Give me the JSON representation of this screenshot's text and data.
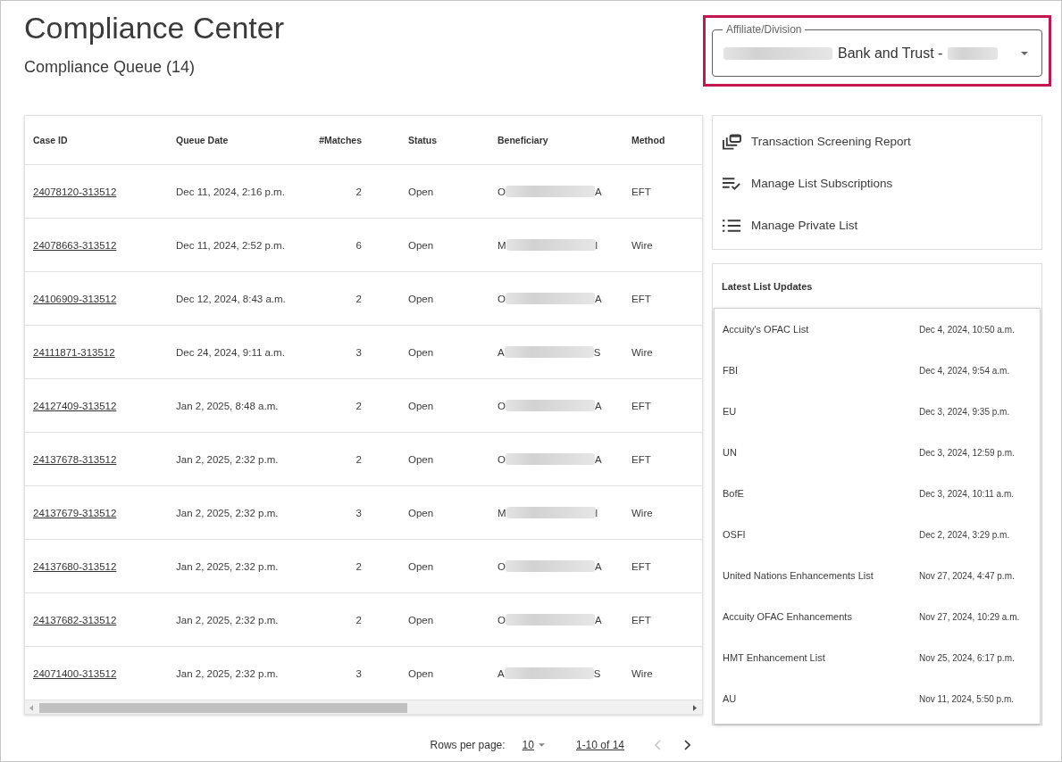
{
  "header": {
    "title": "Compliance Center",
    "subtitle": "Compliance Queue (14)"
  },
  "affiliate_field": {
    "label": "Affiliate/Division",
    "value": "Bank and Trust -",
    "highlighted": true
  },
  "table": {
    "columns": [
      "Case ID",
      "Queue Date",
      "#Matches",
      "Status",
      "Beneficiary",
      "Method"
    ],
    "rows": [
      {
        "case_id": "24078120-313512",
        "queue_date": "Dec 11, 2024, 2:16 p.m.",
        "matches": "2",
        "status": "Open",
        "beneficiary": {
          "first": "O",
          "last": "A"
        },
        "method": "EFT"
      },
      {
        "case_id": "24078663-313512",
        "queue_date": "Dec 11, 2024, 2:52 p.m.",
        "matches": "6",
        "status": "Open",
        "beneficiary": {
          "first": "M",
          "last": "l"
        },
        "method": "Wire"
      },
      {
        "case_id": "24106909-313512",
        "queue_date": "Dec 12, 2024, 8:43 a.m.",
        "matches": "2",
        "status": "Open",
        "beneficiary": {
          "first": "O",
          "last": "A"
        },
        "method": "EFT"
      },
      {
        "case_id": "24111871-313512",
        "queue_date": "Dec 24, 2024, 9:11 a.m.",
        "matches": "3",
        "status": "Open",
        "beneficiary": {
          "first": "A",
          "last": "S"
        },
        "method": "Wire"
      },
      {
        "case_id": "24127409-313512",
        "queue_date": "Jan 2, 2025, 8:48 a.m.",
        "matches": "2",
        "status": "Open",
        "beneficiary": {
          "first": "O",
          "last": "A"
        },
        "method": "EFT"
      },
      {
        "case_id": "24137678-313512",
        "queue_date": "Jan 2, 2025, 2:32 p.m.",
        "matches": "2",
        "status": "Open",
        "beneficiary": {
          "first": "O",
          "last": "A"
        },
        "method": "EFT"
      },
      {
        "case_id": "24137679-313512",
        "queue_date": "Jan 2, 2025, 2:32 p.m.",
        "matches": "3",
        "status": "Open",
        "beneficiary": {
          "first": "M",
          "last": "l"
        },
        "method": "Wire"
      },
      {
        "case_id": "24137680-313512",
        "queue_date": "Jan 2, 2025, 2:32 p.m.",
        "matches": "2",
        "status": "Open",
        "beneficiary": {
          "first": "O",
          "last": "A"
        },
        "method": "EFT"
      },
      {
        "case_id": "24137682-313512",
        "queue_date": "Jan 2, 2025, 2:32 p.m.",
        "matches": "2",
        "status": "Open",
        "beneficiary": {
          "first": "O",
          "last": "A"
        },
        "method": "EFT"
      },
      {
        "case_id": "24071400-313512",
        "queue_date": "Jan 2, 2025, 2:32 p.m.",
        "matches": "3",
        "status": "Open",
        "beneficiary": {
          "first": "A",
          "last": "S"
        },
        "method": "Wire"
      }
    ]
  },
  "pagination": {
    "rows_per_page_label": "Rows per page:",
    "rows_per_page": "10",
    "range": "1-10 of 14",
    "prev_disabled": true,
    "next_disabled": false
  },
  "actions": [
    {
      "label": "Transaction Screening Report"
    },
    {
      "label": "Manage List Subscriptions"
    },
    {
      "label": "Manage Private List"
    }
  ],
  "latest_updates": {
    "title": "Latest List Updates",
    "items": [
      {
        "name": "Accuity's OFAC List",
        "date": "Dec 4, 2024, 10:50 a.m."
      },
      {
        "name": "FBI",
        "date": "Dec 4, 2024, 9:54 a.m."
      },
      {
        "name": "EU",
        "date": "Dec 3, 2024, 9:35 p.m."
      },
      {
        "name": "UN",
        "date": "Dec 3, 2024, 12:59 p.m."
      },
      {
        "name": "BofE",
        "date": "Dec 3, 2024, 10:11 a.m."
      },
      {
        "name": "OSFI",
        "date": "Dec 2, 2024, 3:29 p.m."
      },
      {
        "name": "United Nations Enhancements List",
        "date": "Nov 27, 2024, 4:47 p.m."
      },
      {
        "name": "Accuity OFAC Enhancements",
        "date": "Nov 27, 2024, 10:29 a.m."
      },
      {
        "name": "HMT Enhancement List",
        "date": "Nov 25, 2024, 6:17 p.m."
      },
      {
        "name": "AU",
        "date": "Nov 11, 2024, 5:50 p.m."
      }
    ]
  }
}
